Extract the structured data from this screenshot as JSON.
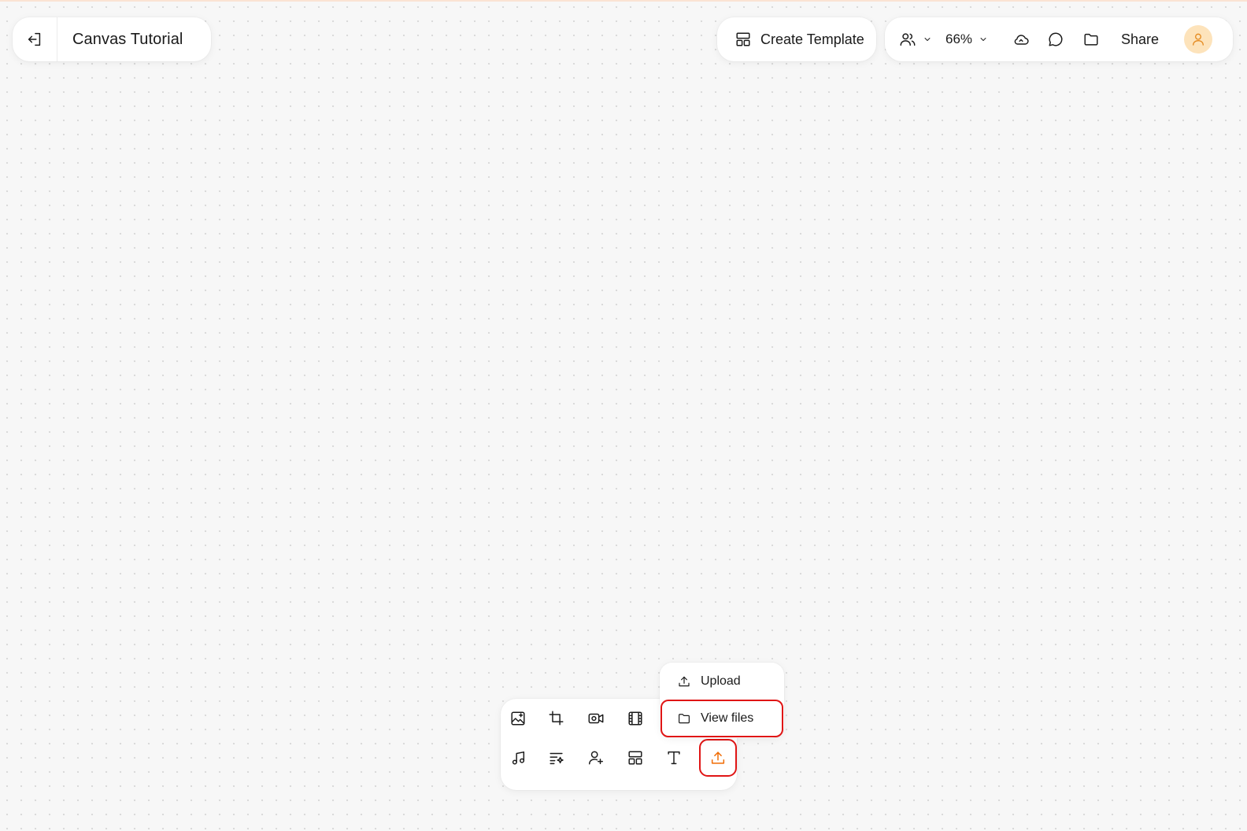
{
  "canvas": {
    "background": "#f7f7f7",
    "dot_color": "#d9d9d9"
  },
  "header": {
    "exit_icon": "exit-icon",
    "title": "Canvas Tutorial"
  },
  "create_template": {
    "icon": "template-icon",
    "label": "Create Template"
  },
  "toolbar": {
    "collaborators_icon": "users-icon",
    "zoom": "66%",
    "sync_icon": "cloud-icon",
    "comment_icon": "comment-icon",
    "files_icon": "folder-icon",
    "share_label": "Share",
    "avatar_icon": "user-icon",
    "avatar_color": "#fde3bb"
  },
  "bottom_tools": {
    "row1": [
      "image-icon",
      "crop-icon",
      "camera-icon",
      "film-icon"
    ],
    "row2": [
      "music-icon",
      "ai-list-icon",
      "add-person-icon",
      "layout-icon",
      "text-icon",
      "upload-icon"
    ],
    "active_tool": "upload-icon"
  },
  "upload_menu": {
    "items": [
      {
        "icon": "upload-icon",
        "label": "Upload"
      },
      {
        "icon": "folder-icon",
        "label": "View files"
      }
    ],
    "highlighted": "View files"
  },
  "colors": {
    "accent": "#f06a00",
    "highlight_border": "#e01515"
  }
}
